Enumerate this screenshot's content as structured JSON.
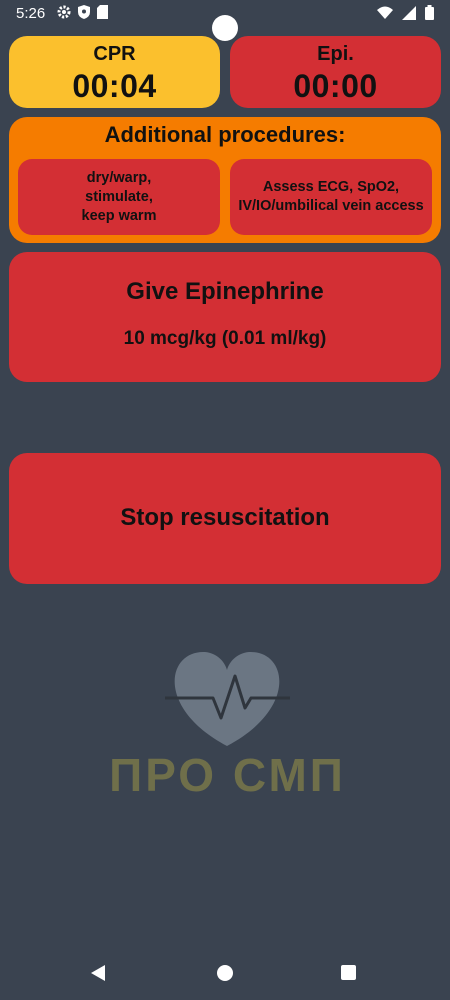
{
  "status_bar": {
    "time": "5:26",
    "icons_left": [
      "gear-icon",
      "shield-icon",
      "sd-card-icon"
    ],
    "icons_right": [
      "wifi-icon",
      "signal-icon",
      "battery-icon"
    ]
  },
  "timers": {
    "cpr": {
      "label": "CPR",
      "value": "00:04",
      "color": "#fbc02d"
    },
    "epi": {
      "label": "Epi.",
      "value": "00:00",
      "color": "#d32f34"
    }
  },
  "procedures": {
    "title": "Additional procedures:",
    "color": "#f57c00",
    "items": [
      {
        "label": "dry/warp,\nstimulate,\nkeep warm"
      },
      {
        "label": "Assess ECG, SpO2,\nIV/IO/umbilical vein access"
      }
    ]
  },
  "epinephrine": {
    "title": "Give Epinephrine",
    "dose": "10 mcg/kg (0.01 ml/kg)"
  },
  "stop": {
    "label": "Stop resuscitation"
  },
  "logo": {
    "text": "ПРО СМП"
  },
  "colors": {
    "background": "#3a4350",
    "red": "#d32f34"
  }
}
